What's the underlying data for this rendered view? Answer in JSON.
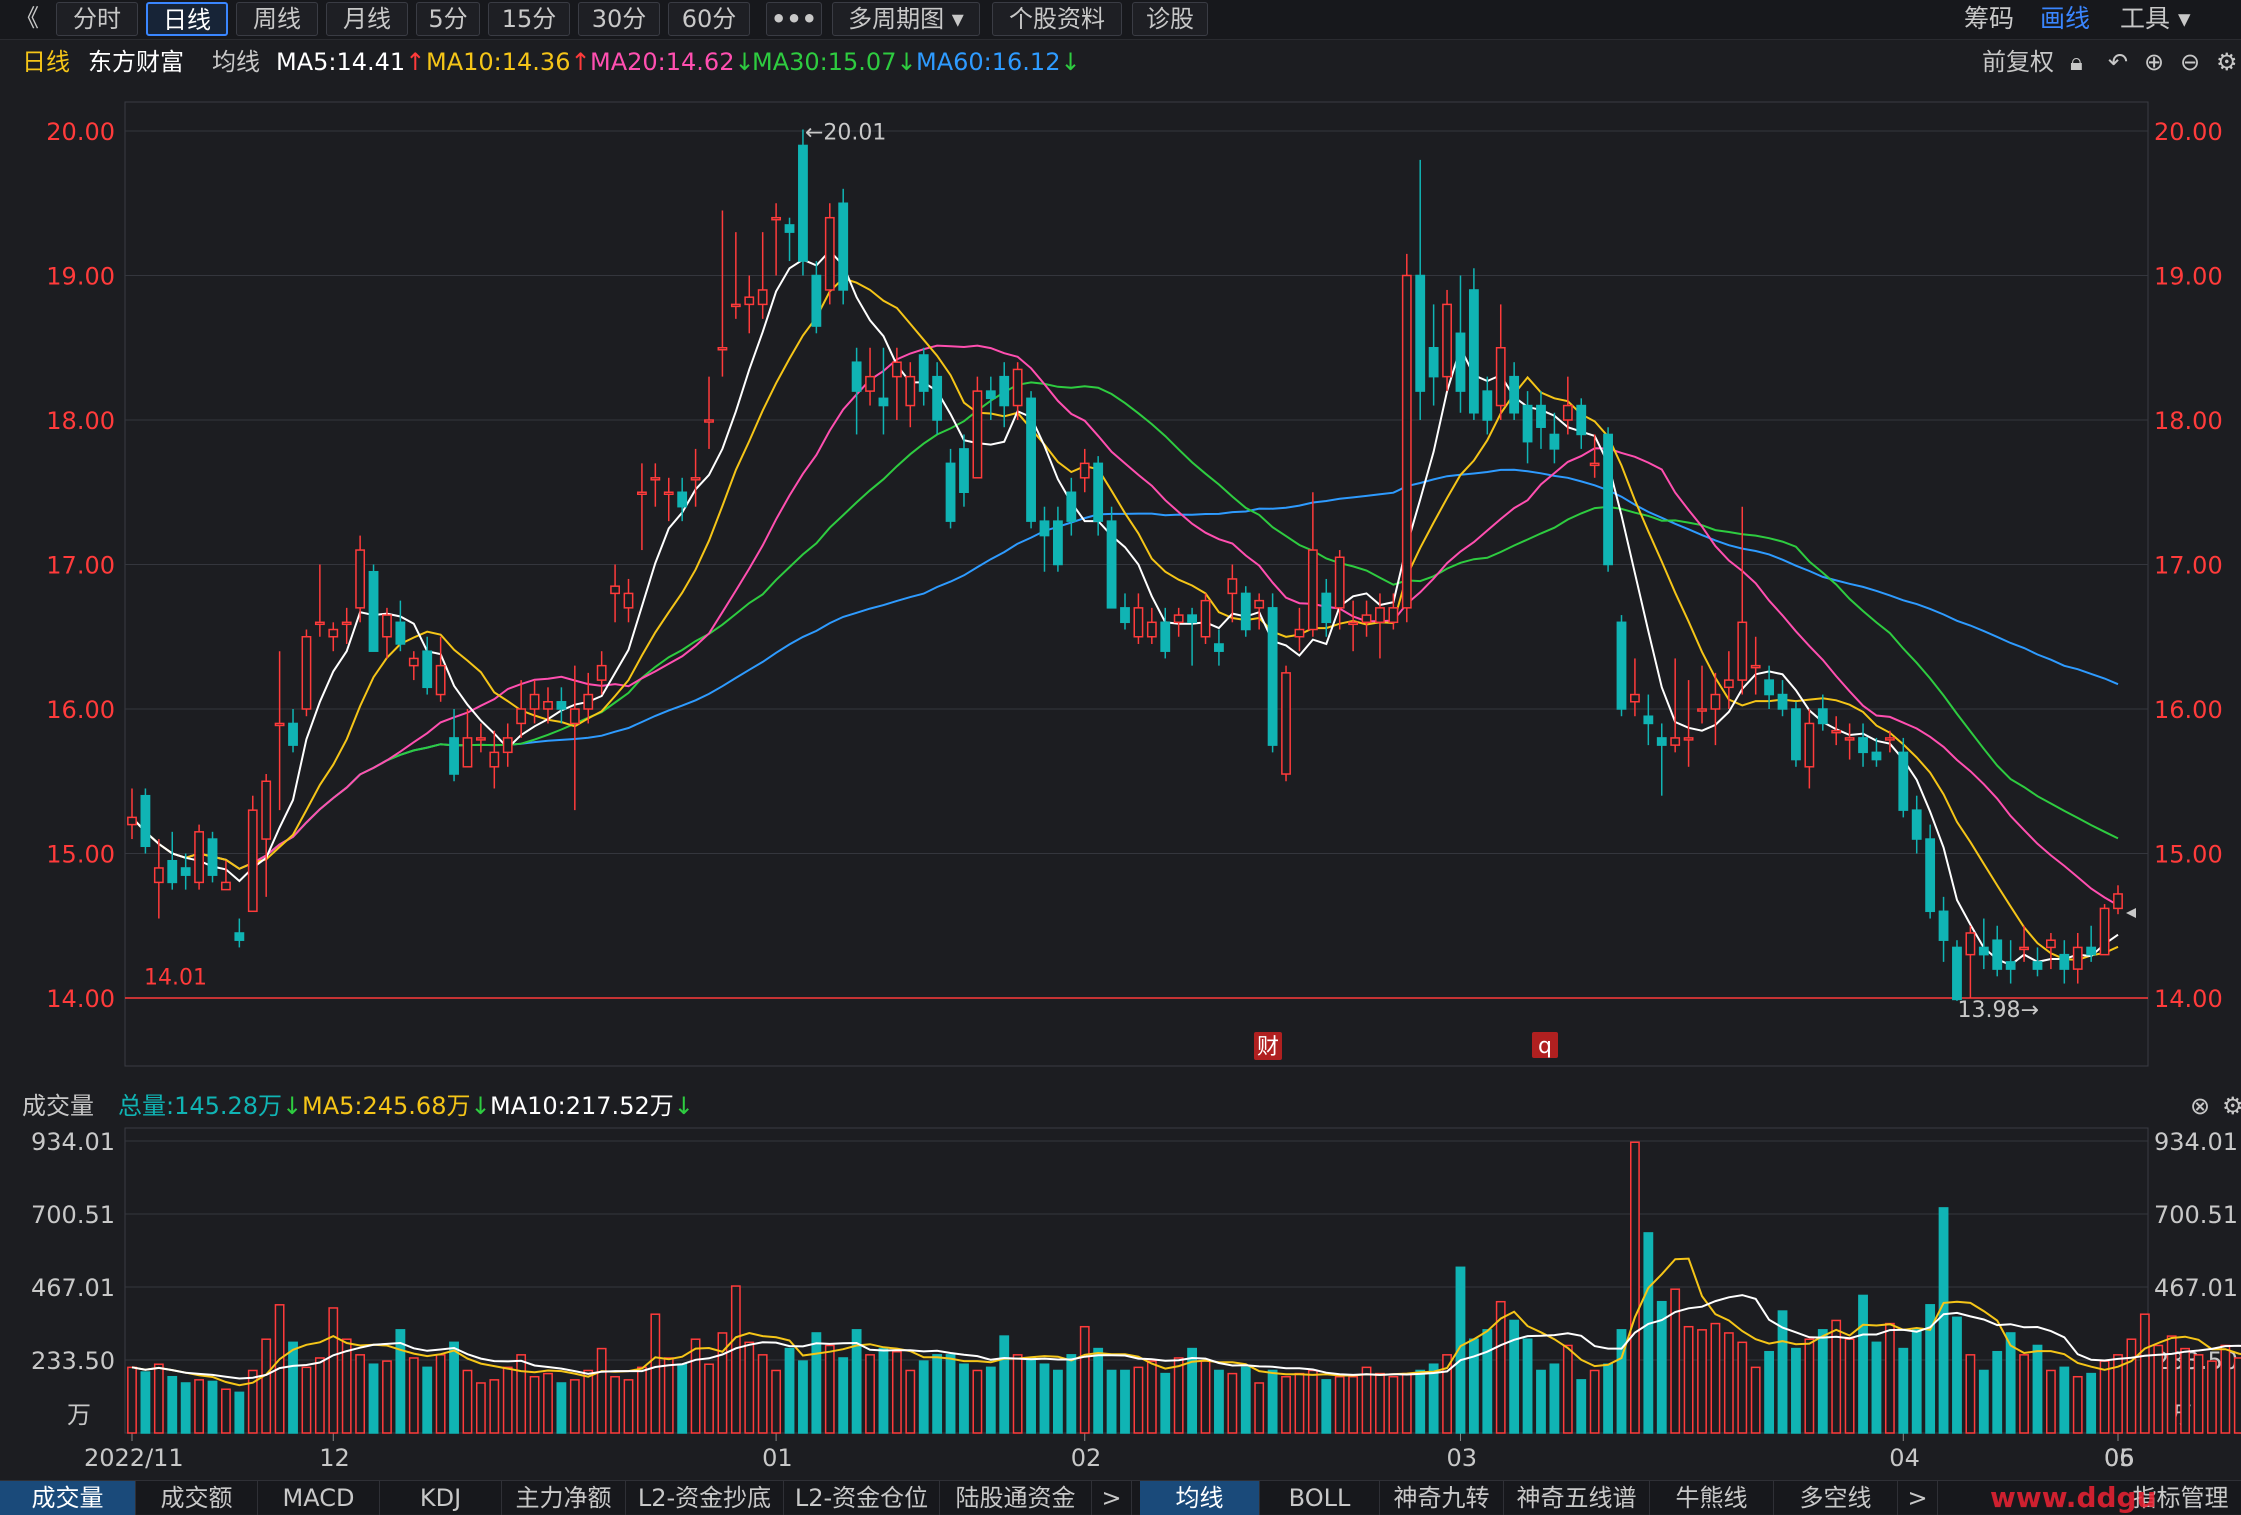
{
  "toolbar": {
    "back": "《",
    "tabs": [
      "分时",
      "日线",
      "周线",
      "月线",
      "5分",
      "15分",
      "30分",
      "60分",
      "•••",
      "多周期图 ▾",
      "个股资料",
      "诊股"
    ],
    "active_tab": "日线",
    "right": [
      "筹码",
      "画线",
      "工具 ▾"
    ]
  },
  "info": {
    "period": "日线",
    "stock": "东方财富",
    "ma_label": "均线",
    "ma5": "MA5:14.41",
    "ma10": "MA10:14.36",
    "ma20": "MA20:14.62",
    "ma30": "MA30:15.07",
    "ma60": "MA60:16.12",
    "fuquan": "前复权"
  },
  "volume_header": {
    "label": "成交量",
    "total": "总量:145.28万",
    "ma5": "MA5:245.68万",
    "ma10": "MA10:217.52万"
  },
  "bottom_tabs": [
    "成交量",
    "成交额",
    "MACD",
    "KDJ",
    "主力净额",
    "L2-资金抄底",
    "L2-资金仓位",
    "陆股通资金",
    ">",
    "均线",
    "BOLL",
    "神奇九转",
    "神奇五线谱",
    "牛熊线",
    "多空线",
    ">",
    "指标管理"
  ],
  "watermark": "www.ddgu",
  "colors": {
    "up": "#ff3b3b",
    "down": "#10b4b4",
    "ma5": "#ffffff",
    "ma10": "#f5c518",
    "ma20": "#ff4fb0",
    "ma30": "#2ecc40",
    "ma60": "#2e9bff",
    "axis": "#ff3b3b"
  },
  "chart_data": {
    "type": "candlestick",
    "price_axis": {
      "ticks": [
        "20.00",
        "19.00",
        "18.00",
        "17.00",
        "16.00",
        "15.00",
        "14.00"
      ],
      "ylim": [
        13.55,
        20.1
      ]
    },
    "volume_axis": {
      "ticks": [
        "934.01",
        "700.51",
        "467.01",
        "233.50"
      ],
      "unit": "万"
    },
    "x_labels": [
      "2022/11",
      "12",
      "01",
      "02",
      "03",
      "04",
      "05",
      "06"
    ],
    "annotations": {
      "high": "←20.01",
      "low": "13.98→",
      "start_low": "14.01",
      "marker1": "财",
      "marker2": "q"
    },
    "candles": [
      [
        15.2,
        15.25,
        15.45,
        15.1
      ],
      [
        15.4,
        15.05,
        15.45,
        15.0
      ],
      [
        14.8,
        14.9,
        15.1,
        14.55
      ],
      [
        14.95,
        14.8,
        15.15,
        14.75
      ],
      [
        14.9,
        14.85,
        15.0,
        14.75
      ],
      [
        14.8,
        15.15,
        15.2,
        14.75
      ],
      [
        15.1,
        14.85,
        15.15,
        14.8
      ],
      [
        14.75,
        14.8,
        14.95,
        14.75
      ],
      [
        14.45,
        14.4,
        14.55,
        14.35
      ],
      [
        14.6,
        15.3,
        15.4,
        14.6
      ],
      [
        15.1,
        15.5,
        15.55,
        14.7
      ],
      [
        15.9,
        15.9,
        16.4,
        15.3
      ],
      [
        15.9,
        15.75,
        16.0,
        15.7
      ],
      [
        16.0,
        16.5,
        16.55,
        15.95
      ],
      [
        16.6,
        16.6,
        17.0,
        16.5
      ],
      [
        16.5,
        16.55,
        16.6,
        16.4
      ],
      [
        16.6,
        16.6,
        16.7,
        16.45
      ],
      [
        16.7,
        17.1,
        17.2,
        16.6
      ],
      [
        16.95,
        16.4,
        17.0,
        16.4
      ],
      [
        16.5,
        16.65,
        16.7,
        16.35
      ],
      [
        16.6,
        16.45,
        16.75,
        16.4
      ],
      [
        16.3,
        16.35,
        16.4,
        16.2
      ],
      [
        16.4,
        16.15,
        16.5,
        16.1
      ],
      [
        16.1,
        16.3,
        16.5,
        16.05
      ],
      [
        15.8,
        15.55,
        16.0,
        15.5
      ],
      [
        15.6,
        15.8,
        16.0,
        15.6
      ],
      [
        15.8,
        15.8,
        15.9,
        15.7
      ],
      [
        15.6,
        15.7,
        15.85,
        15.45
      ],
      [
        15.7,
        15.8,
        15.9,
        15.6
      ],
      [
        15.9,
        16.0,
        16.2,
        15.8
      ],
      [
        16.0,
        16.1,
        16.2,
        15.9
      ],
      [
        16.0,
        16.05,
        16.15,
        15.9
      ],
      [
        16.05,
        16.0,
        16.15,
        15.9
      ],
      [
        15.9,
        16.0,
        16.3,
        15.3
      ],
      [
        16.0,
        16.1,
        16.25,
        15.9
      ],
      [
        16.2,
        16.3,
        16.4,
        16.1
      ],
      [
        16.8,
        16.85,
        17.0,
        16.6
      ],
      [
        16.7,
        16.8,
        16.9,
        16.6
      ],
      [
        17.5,
        17.5,
        17.7,
        17.1
      ],
      [
        17.6,
        17.6,
        17.7,
        17.4
      ],
      [
        17.5,
        17.5,
        17.6,
        17.3
      ],
      [
        17.5,
        17.4,
        17.6,
        17.3
      ],
      [
        17.6,
        17.6,
        17.8,
        17.4
      ],
      [
        18.0,
        18.0,
        18.3,
        17.8
      ],
      [
        18.5,
        18.5,
        19.45,
        18.3
      ],
      [
        18.8,
        18.8,
        19.3,
        18.7
      ],
      [
        18.8,
        18.85,
        19.0,
        18.6
      ],
      [
        18.8,
        18.9,
        19.3,
        18.7
      ],
      [
        19.4,
        19.4,
        19.5,
        19.0
      ],
      [
        19.35,
        19.3,
        19.4,
        19.1
      ],
      [
        19.9,
        19.1,
        20.01,
        19.0
      ],
      [
        19.0,
        18.65,
        19.1,
        18.6
      ],
      [
        18.9,
        19.4,
        19.5,
        18.8
      ],
      [
        19.5,
        18.9,
        19.6,
        18.8
      ],
      [
        18.4,
        18.2,
        18.5,
        17.9
      ],
      [
        18.2,
        18.3,
        18.5,
        18.1
      ],
      [
        18.15,
        18.1,
        18.5,
        17.9
      ],
      [
        18.3,
        18.4,
        18.5,
        18.0
      ],
      [
        18.1,
        18.3,
        18.4,
        17.95
      ],
      [
        18.45,
        18.2,
        18.5,
        18.1
      ],
      [
        18.3,
        18.0,
        18.4,
        17.9
      ],
      [
        17.7,
        17.3,
        17.8,
        17.25
      ],
      [
        17.8,
        17.5,
        17.9,
        17.4
      ],
      [
        17.6,
        18.2,
        18.3,
        17.6
      ],
      [
        18.2,
        18.15,
        18.3,
        18.0
      ],
      [
        18.3,
        18.1,
        18.4,
        17.95
      ],
      [
        18.1,
        18.35,
        18.4,
        18.0
      ],
      [
        18.15,
        17.3,
        18.2,
        17.25
      ],
      [
        17.3,
        17.2,
        17.4,
        16.95
      ],
      [
        17.3,
        17.0,
        17.4,
        16.95
      ],
      [
        17.5,
        17.3,
        17.6,
        17.2
      ],
      [
        17.6,
        17.7,
        17.8,
        17.5
      ],
      [
        17.7,
        17.3,
        17.75,
        17.2
      ],
      [
        17.3,
        16.7,
        17.4,
        16.7
      ],
      [
        16.7,
        16.6,
        16.8,
        16.55
      ],
      [
        16.5,
        16.7,
        16.8,
        16.45
      ],
      [
        16.5,
        16.6,
        16.7,
        16.45
      ],
      [
        16.6,
        16.4,
        16.7,
        16.35
      ],
      [
        16.6,
        16.65,
        16.7,
        16.5
      ],
      [
        16.65,
        16.6,
        16.7,
        16.3
      ],
      [
        16.5,
        16.75,
        16.8,
        16.45
      ],
      [
        16.45,
        16.4,
        16.55,
        16.3
      ],
      [
        16.8,
        16.9,
        17.0,
        16.6
      ],
      [
        16.8,
        16.55,
        16.85,
        16.5
      ],
      [
        16.7,
        16.75,
        16.8,
        16.55
      ],
      [
        16.7,
        15.75,
        16.8,
        15.7
      ],
      [
        15.55,
        16.25,
        16.3,
        15.5
      ],
      [
        16.5,
        16.55,
        16.7,
        16.4
      ],
      [
        16.55,
        17.1,
        17.5,
        16.5
      ],
      [
        16.8,
        16.6,
        16.9,
        16.5
      ],
      [
        16.7,
        17.05,
        17.1,
        16.55
      ],
      [
        16.6,
        16.6,
        16.75,
        16.4
      ],
      [
        16.6,
        16.65,
        16.75,
        16.5
      ],
      [
        16.6,
        16.7,
        16.8,
        16.35
      ],
      [
        16.6,
        16.7,
        16.8,
        16.55
      ],
      [
        16.7,
        19.0,
        19.15,
        16.6
      ],
      [
        19.0,
        18.2,
        19.8,
        18.0
      ],
      [
        18.5,
        18.3,
        18.8,
        18.1
      ],
      [
        18.3,
        18.8,
        18.9,
        18.2
      ],
      [
        18.6,
        18.2,
        19.0,
        18.05
      ],
      [
        18.9,
        18.05,
        19.05,
        18.0
      ],
      [
        18.2,
        18.0,
        18.3,
        17.9
      ],
      [
        18.1,
        18.5,
        18.8,
        18.0
      ],
      [
        18.3,
        18.05,
        18.4,
        18.0
      ],
      [
        18.1,
        17.85,
        18.2,
        17.7
      ],
      [
        18.1,
        17.95,
        18.2,
        17.8
      ],
      [
        17.9,
        17.8,
        18.05,
        17.7
      ],
      [
        18.0,
        18.1,
        18.3,
        17.9
      ],
      [
        18.1,
        17.9,
        18.15,
        17.8
      ],
      [
        17.7,
        17.7,
        17.9,
        17.6
      ],
      [
        17.9,
        17.0,
        17.95,
        16.95
      ],
      [
        16.6,
        16.0,
        16.65,
        15.95
      ],
      [
        16.05,
        16.1,
        16.35,
        15.95
      ],
      [
        15.95,
        15.9,
        16.1,
        15.75
      ],
      [
        15.8,
        15.75,
        15.9,
        15.4
      ],
      [
        15.75,
        15.8,
        16.35,
        15.7
      ],
      [
        15.8,
        15.8,
        16.2,
        15.6
      ],
      [
        16.0,
        16.0,
        16.3,
        15.9
      ],
      [
        16.0,
        16.1,
        16.25,
        15.75
      ],
      [
        16.15,
        16.2,
        16.4,
        16.0
      ],
      [
        16.2,
        16.6,
        17.4,
        16.1
      ],
      [
        16.3,
        16.3,
        16.5,
        16.1
      ],
      [
        16.2,
        16.1,
        16.3,
        16.0
      ],
      [
        16.1,
        16.0,
        16.2,
        15.95
      ],
      [
        16.0,
        15.65,
        16.05,
        15.6
      ],
      [
        15.6,
        15.9,
        16.0,
        15.45
      ],
      [
        16.0,
        15.9,
        16.1,
        15.85
      ],
      [
        15.85,
        15.85,
        15.95,
        15.75
      ],
      [
        15.8,
        15.8,
        15.9,
        15.65
      ],
      [
        15.8,
        15.7,
        15.9,
        15.6
      ],
      [
        15.7,
        15.65,
        15.8,
        15.6
      ],
      [
        15.8,
        15.8,
        15.85,
        15.7
      ],
      [
        15.7,
        15.3,
        15.8,
        15.25
      ],
      [
        15.3,
        15.1,
        15.4,
        15.0
      ],
      [
        15.1,
        14.6,
        15.2,
        14.55
      ],
      [
        14.6,
        14.4,
        14.7,
        14.25
      ],
      [
        14.35,
        13.99,
        14.4,
        13.98
      ],
      [
        14.3,
        14.45,
        14.5,
        14.0
      ],
      [
        14.35,
        14.3,
        14.55,
        14.2
      ],
      [
        14.4,
        14.2,
        14.5,
        14.15
      ],
      [
        14.25,
        14.2,
        14.4,
        14.1
      ],
      [
        14.35,
        14.35,
        14.5,
        14.25
      ],
      [
        14.25,
        14.2,
        14.35,
        14.15
      ],
      [
        14.35,
        14.4,
        14.45,
        14.2
      ],
      [
        14.3,
        14.2,
        14.4,
        14.1
      ],
      [
        14.2,
        14.35,
        14.45,
        14.1
      ],
      [
        14.35,
        14.3,
        14.5,
        14.25
      ],
      [
        14.3,
        14.62,
        14.65,
        14.3
      ],
      [
        14.62,
        14.72,
        14.78,
        14.58
      ]
    ],
    "volumes": [
      210,
      195,
      220,
      180,
      160,
      170,
      165,
      140,
      130,
      200,
      300,
      410,
      290,
      210,
      240,
      400,
      300,
      250,
      220,
      230,
      330,
      240,
      210,
      250,
      290,
      200,
      160,
      170,
      210,
      250,
      180,
      190,
      160,
      170,
      200,
      270,
      180,
      170,
      210,
      380,
      240,
      220,
      300,
      220,
      320,
      470,
      290,
      250,
      200,
      270,
      230,
      320,
      280,
      240,
      330,
      250,
      270,
      260,
      200,
      230,
      250,
      250,
      220,
      200,
      210,
      310,
      250,
      240,
      220,
      200,
      250,
      340,
      270,
      200,
      200,
      210,
      230,
      190,
      240,
      270,
      230,
      200,
      190,
      210,
      160,
      200,
      180,
      190,
      200,
      170,
      180,
      180,
      210,
      190,
      180,
      190,
      200,
      220,
      250,
      530,
      300,
      330,
      420,
      360,
      300,
      200,
      220,
      280,
      170,
      200,
      220,
      330,
      930,
      640,
      420,
      460,
      340,
      330,
      350,
      320,
      290,
      210,
      260,
      390,
      270,
      300,
      330,
      360,
      300,
      440,
      290,
      350,
      270,
      330,
      410,
      720,
      370,
      250,
      200,
      260,
      320,
      250,
      280,
      200,
      210,
      180,
      190,
      230,
      250,
      300,
      380,
      280,
      310,
      270,
      250,
      230,
      280,
      240,
      230,
      260,
      210,
      250,
      220,
      260,
      250,
      190,
      230,
      250,
      210,
      260,
      400,
      145
    ]
  }
}
